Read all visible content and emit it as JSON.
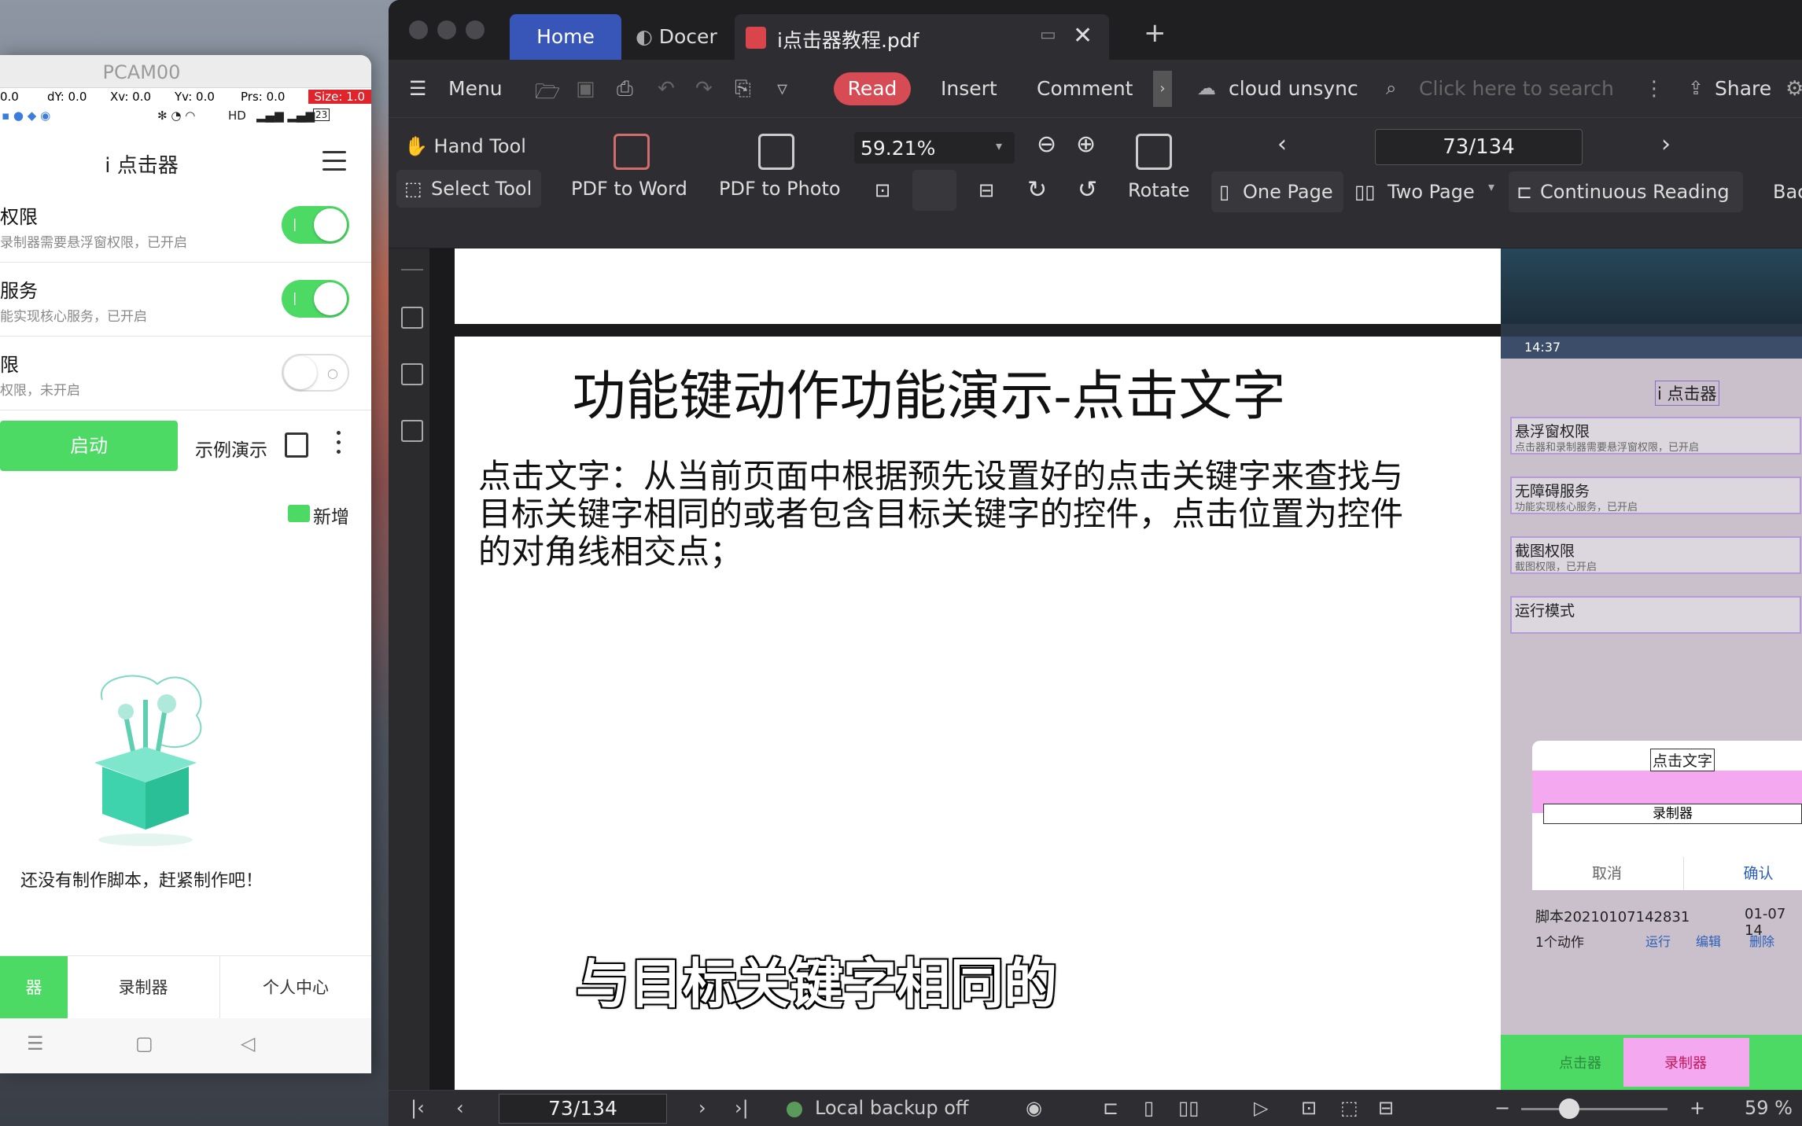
{
  "phone": {
    "window_title": "PCAM00",
    "pointer": {
      "x": "0.0",
      "dy": "dY: 0.0",
      "xv": "Xv: 0.0",
      "yv": "Yv: 0.0",
      "prs": "Prs: 0.0",
      "size": "Size: 1.0"
    },
    "status_right": "HD",
    "battery": "23",
    "app_title": "i 点击器",
    "permissions": [
      {
        "title": "权限",
        "subtitle": "录制器需要悬浮窗权限，已开启",
        "on": true
      },
      {
        "title": "服务",
        "subtitle": "能实现核心服务，已开启",
        "on": true
      },
      {
        "title": "限",
        "subtitle": "权限，未开启",
        "on": false
      }
    ],
    "start_button": "启动",
    "demo_link": "示例演示",
    "new_button": "新增",
    "empty_text": "还没有制作脚本，赶紧制作吧！",
    "tabs": [
      "器",
      "录制器",
      "个人中心"
    ]
  },
  "pdf": {
    "tabs": {
      "home": "Home",
      "docer": "Docer",
      "file": "i点击器教程.pdf"
    },
    "menu": {
      "menu": "Menu",
      "read": "Read",
      "insert": "Insert",
      "comment": "Comment",
      "cloud": "cloud unsync",
      "search_placeholder": "Click here to search",
      "share": "Share"
    },
    "toolbar": {
      "hand_tool": "Hand Tool",
      "select_tool": "Select Tool",
      "pdf_to_word": "PDF to Word",
      "pdf_to_photo": "PDF to Photo",
      "zoom": "59.21%",
      "page": "73/134",
      "rotate": "Rotate",
      "one_page": "One Page",
      "two_page": "Two Page",
      "continuous": "Continuous Reading",
      "back": "Bac"
    },
    "document": {
      "title": "功能键动作功能演示-点击文字",
      "body": "点击文字：从当前页面中根据预先设置好的点击关键字来查找与目标关键字相同的或者包含目标关键字的控件，点击位置为控件的对角线相交点；",
      "subtitle": "与目标关键字相同的"
    },
    "embedded": {
      "time": "14:37",
      "app_title": "i 点击器",
      "rows": [
        {
          "a": "悬浮窗权限",
          "b": "点击器和录制器需要悬浮窗权限，已开启"
        },
        {
          "a": "无障碍服务",
          "b": "功能实现核心服务，已开启"
        },
        {
          "a": "截图权限",
          "b": "截图权限，已开启"
        },
        {
          "a": "运行模式",
          "b": ""
        }
      ],
      "dialog_title": "点击文字",
      "dialog_field": "录制器",
      "cancel": "取消",
      "confirm": "确认",
      "script_name": "脚本20210107142831",
      "script_date": "01-07 14",
      "actions": "1个动作",
      "run": "运行",
      "edit": "编辑",
      "delete": "删除",
      "bottom_left": "点击器",
      "bottom_right": "录制器"
    },
    "status": {
      "page": "73/134",
      "backup": "Local backup off",
      "zoom": "59 %"
    }
  }
}
